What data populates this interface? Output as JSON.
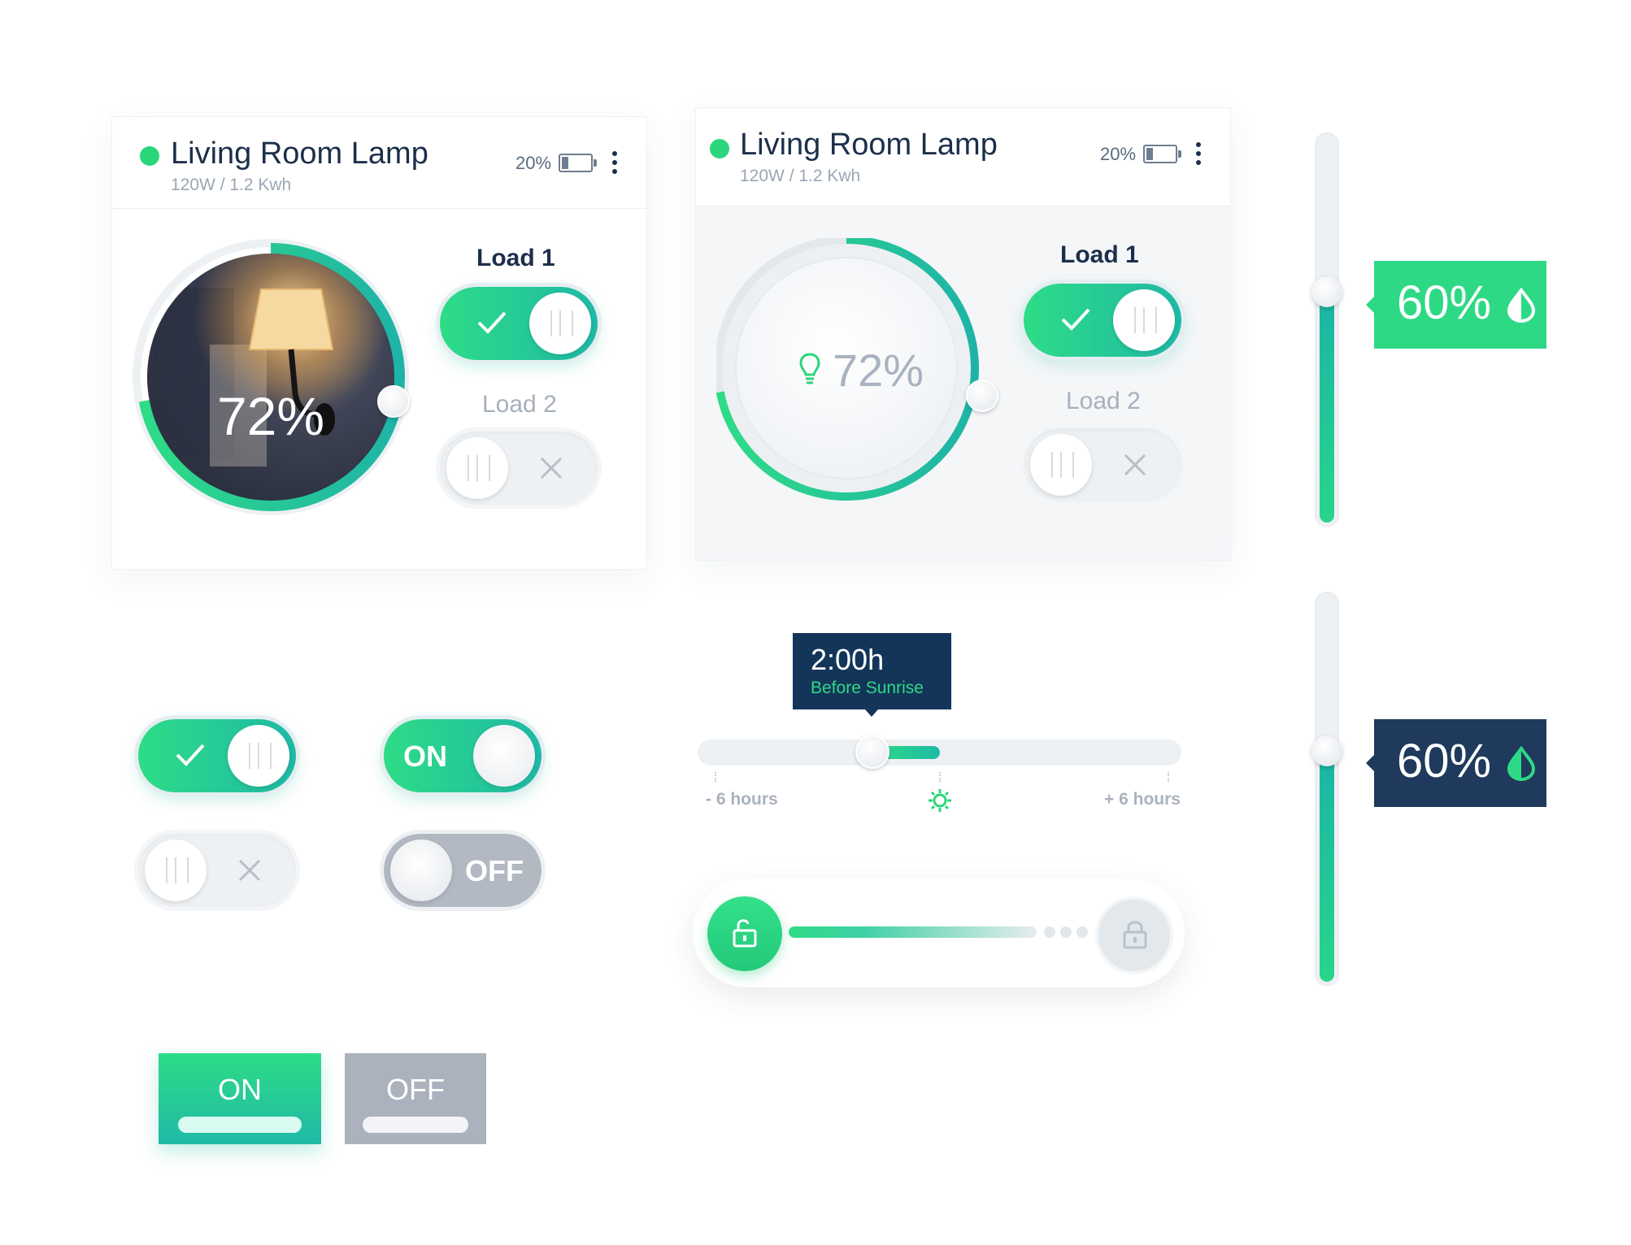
{
  "cards": [
    {
      "title": "Living Room Lamp",
      "subtitle": "120W / 1.2 Kwh",
      "battery_text": "20%",
      "battery_level": 0.2,
      "dial_value": "72%",
      "dial_level": 0.72,
      "load1_label": "Load 1",
      "load2_label": "Load 2",
      "load1_on": true,
      "load2_on": false
    },
    {
      "title": "Living Room Lamp",
      "subtitle": "120W / 1.2 Kwh",
      "battery_text": "20%",
      "battery_level": 0.2,
      "dial_value": "72%",
      "dial_level": 0.72,
      "load1_label": "Load 1",
      "load2_label": "Load 2",
      "load1_on": true,
      "load2_on": false
    }
  ],
  "toggles": {
    "on_label": "ON",
    "off_label": "OFF"
  },
  "time_slider": {
    "tooltip_time": "2:00h",
    "tooltip_caption": "Before Sunrise",
    "min_label": "- 6 hours",
    "max_label": "+ 6 hours"
  },
  "vertical_sliders": [
    {
      "value": "60%",
      "level": 0.6,
      "theme": "green"
    },
    {
      "value": "60%",
      "level": 0.6,
      "theme": "navy"
    }
  ],
  "buttons": {
    "on_label": "ON",
    "off_label": "OFF"
  },
  "colors": {
    "accent_green": "#2edc86",
    "accent_teal": "#1fb9a6",
    "navy": "#1f3a5c",
    "tooltip_navy": "#13355a",
    "muted_gray": "#b3b9c2"
  },
  "icons": [
    "more-vert-icon",
    "battery-icon",
    "check-icon",
    "close-icon",
    "bulb-icon",
    "sun-icon",
    "lock-open-icon",
    "lock-icon",
    "drop-icon"
  ]
}
